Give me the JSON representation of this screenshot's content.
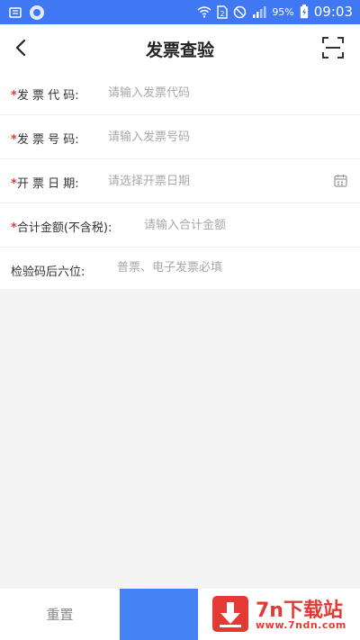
{
  "status_bar": {
    "battery_percent": "95%",
    "time": "09:03",
    "icons": [
      "notification-icon",
      "message-icon",
      "wifi-icon",
      "sim-icon",
      "dnd-icon",
      "signal-icon",
      "battery-icon"
    ]
  },
  "header": {
    "title": "发票查验",
    "back_icon": "back-arrow-icon",
    "scan_icon": "scan-icon"
  },
  "form": {
    "invoice_code": {
      "label": "发 票 代 码:",
      "required": true,
      "placeholder": "请输入发票代码"
    },
    "invoice_number": {
      "label": "发 票 号 码:",
      "required": true,
      "placeholder": "请输入发票号码"
    },
    "invoice_date": {
      "label": "开 票 日 期:",
      "required": true,
      "placeholder": "请选择开票日期",
      "icon": "calendar-icon"
    },
    "amount": {
      "label": "合计金额(不含税):",
      "required": true,
      "placeholder": "请输入合计金额"
    },
    "check_code": {
      "label": "检验码后六位:",
      "required": false,
      "placeholder": "普票、电子发票必填"
    }
  },
  "footer": {
    "reset_label": "重置",
    "submit_label": ""
  },
  "watermark": {
    "name": "7n下载站",
    "url": "www.7ndn.com"
  },
  "colors": {
    "status_bar": "#3f78f2",
    "primary_button": "#4282f5",
    "required_star": "#e53935",
    "background": "#f4f4f4"
  }
}
